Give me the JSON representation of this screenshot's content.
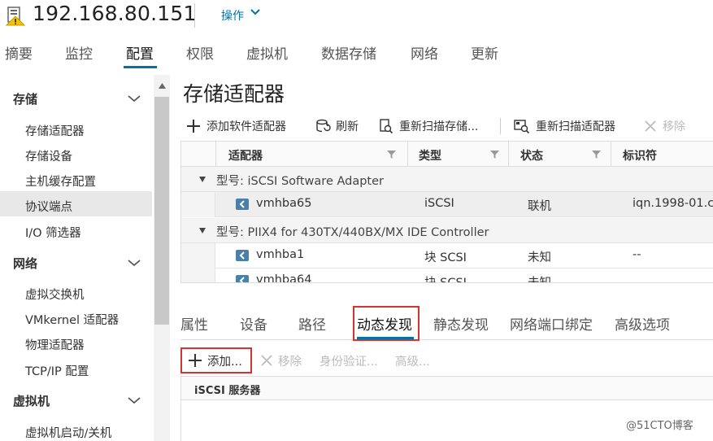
{
  "header": {
    "host_title": "192.168.80.151",
    "actions_label": "操作",
    "warning_icon": "warning-icon",
    "accent_color": "#0072a3"
  },
  "top_tabs": [
    "摘要",
    "监控",
    "配置",
    "权限",
    "虚拟机",
    "数据存储",
    "网络",
    "更新"
  ],
  "top_tabs_active": "配置",
  "sidebar": {
    "sections": [
      {
        "label": "存储",
        "items": [
          "存储适配器",
          "存储设备",
          "主机缓存配置",
          "协议端点",
          "I/O 筛选器"
        ]
      },
      {
        "label": "网络",
        "items": [
          "虚拟交换机",
          "VMkernel 适配器",
          "物理适配器",
          "TCP/IP 配置"
        ]
      },
      {
        "label": "虚拟机",
        "items": [
          "虚拟机启动/关机"
        ]
      }
    ],
    "selected_item": "存储适配器"
  },
  "main": {
    "title": "存储适配器",
    "toolbar": {
      "add_software": "添加软件适配器",
      "refresh": "刷新",
      "rescan_storage": "重新扫描存储...",
      "rescan_adapter": "重新扫描适配器",
      "remove": "移除"
    },
    "grid": {
      "columns": [
        "适配器",
        "类型",
        "状态",
        "标识符"
      ],
      "groups": [
        {
          "label": "型号: iSCSI Software Adapter",
          "rows": [
            {
              "adapter": "vmhba65",
              "type": "iSCSI",
              "status": "联机",
              "identifier": "iqn.1998-01.co"
            }
          ]
        },
        {
          "label": "型号: PIIX4 for 430TX/440BX/MX IDE Controller",
          "rows": [
            {
              "adapter": "vmhba1",
              "type": "块 SCSI",
              "status": "未知",
              "identifier": "--"
            },
            {
              "adapter": "vmhba64",
              "type": "块 SCSI",
              "status": "未知",
              "identifier": ""
            }
          ]
        }
      ]
    },
    "detail_tabs": [
      "属性",
      "设备",
      "路径",
      "动态发现",
      "静态发现",
      "网络端口绑定",
      "高级选项"
    ],
    "detail_tabs_active": "动态发现",
    "detail_toolbar": {
      "add": "添加...",
      "remove": "移除",
      "auth": "身份验证...",
      "advanced": "高级..."
    },
    "server_grid": {
      "column": "iSCSI 服务器"
    }
  },
  "watermark": "@51CTO博客"
}
